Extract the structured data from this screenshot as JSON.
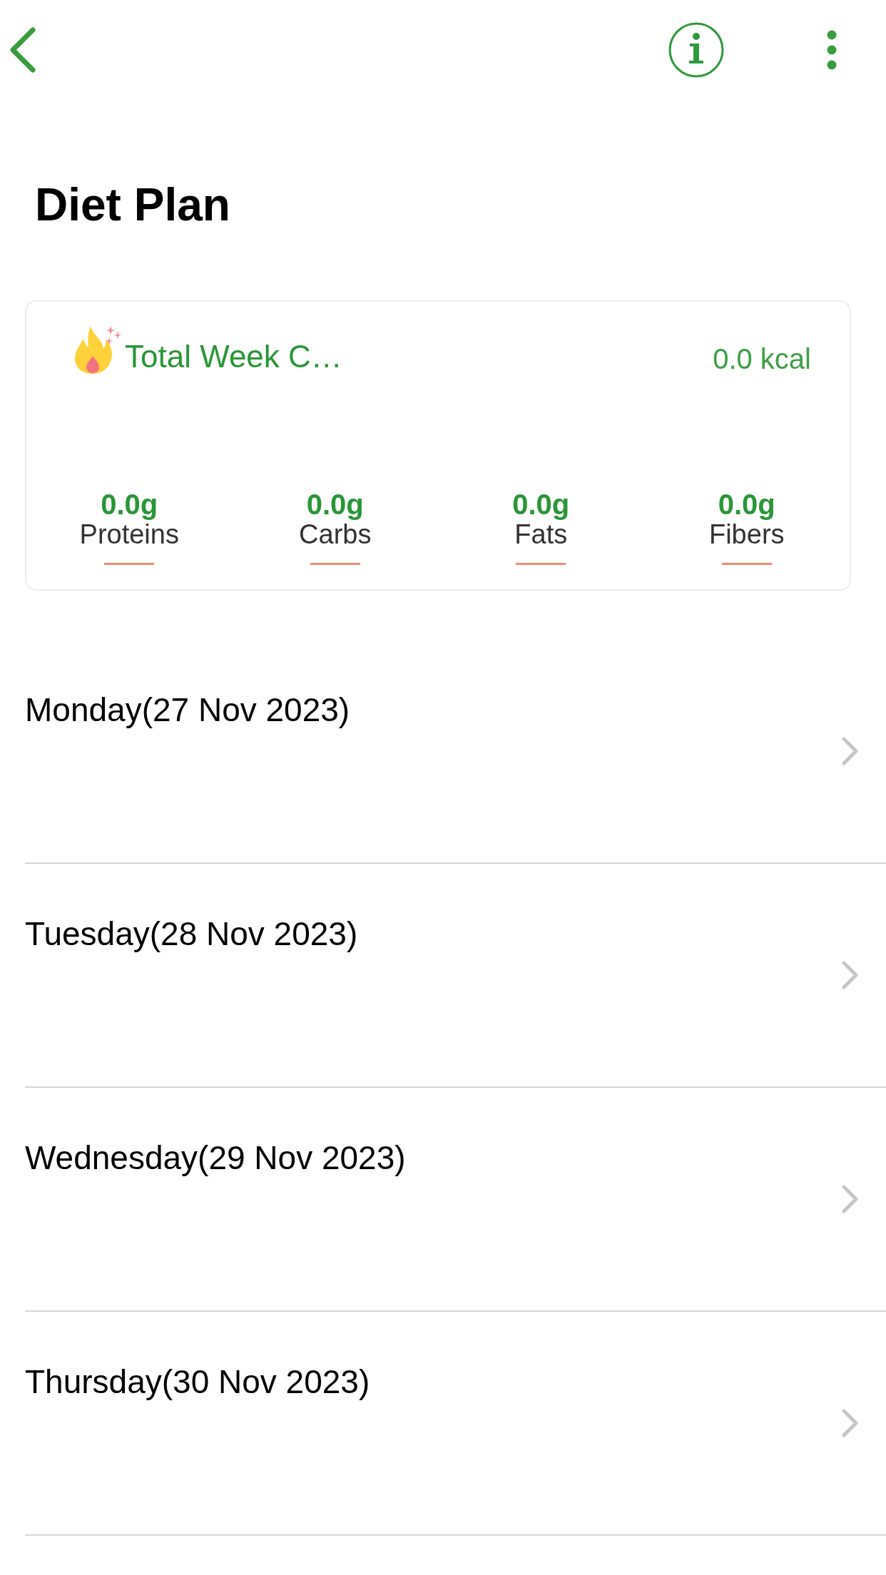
{
  "title": "Diet Plan",
  "summary": {
    "title": "Total Week C…",
    "calories": "0.0 kcal",
    "macros": [
      {
        "value": "0.0g",
        "label": "Proteins"
      },
      {
        "value": "0.0g",
        "label": "Carbs"
      },
      {
        "value": "0.0g",
        "label": "Fats"
      },
      {
        "value": "0.0g",
        "label": "Fibers"
      }
    ]
  },
  "days": [
    {
      "label": "Monday(27 Nov 2023)"
    },
    {
      "label": "Tuesday(28 Nov 2023)"
    },
    {
      "label": "Wednesday(29 Nov 2023)"
    },
    {
      "label": "Thursday(30 Nov 2023)"
    }
  ]
}
